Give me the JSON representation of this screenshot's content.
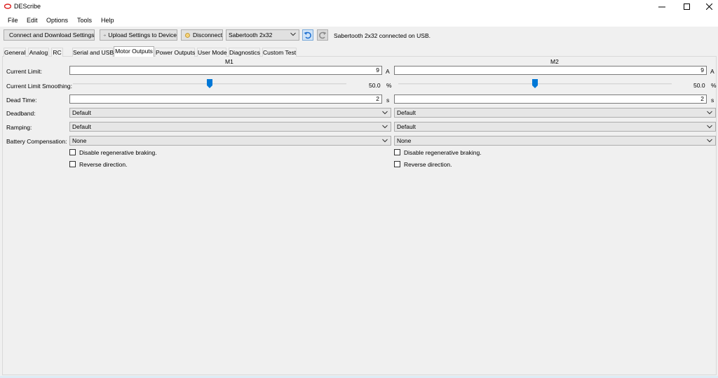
{
  "window": {
    "title": "DEScribe"
  },
  "menu": [
    "File",
    "Edit",
    "Options",
    "Tools",
    "Help"
  ],
  "toolbar": {
    "connect_label": "Connect and Download Settings",
    "upload_label": "Upload Settings to Device",
    "disconnect_label": "Disconnect",
    "device_select": "Sabertooth 2x32",
    "status": "Sabertooth 2x32 connected on USB."
  },
  "tabs": [
    "General",
    "Analog",
    "RC",
    "Serial and USB",
    "Motor Outputs",
    "Power Outputs",
    "User Mode",
    "Diagnostics",
    "Custom Test"
  ],
  "active_tab": "Motor Outputs",
  "columns": {
    "m1": "M1",
    "m2": "M2"
  },
  "labels": {
    "current_limit": "Current Limit:",
    "current_limit_smoothing": "Current Limit Smoothing:",
    "dead_time": "Dead Time:",
    "deadband": "Deadband:",
    "ramping": "Ramping:",
    "battery_compensation": "Battery Compensation:"
  },
  "m1": {
    "current_limit": "9",
    "current_unit": "A",
    "smoothing_value": "50.0",
    "smoothing_unit": "%",
    "smoothing_fraction": 0.5,
    "dead_time": "2",
    "dead_time_unit": "s",
    "deadband": "Default",
    "ramping": "Default",
    "battery_compensation": "None",
    "disable_regen_label": "Disable regenerative braking.",
    "disable_regen_checked": false,
    "reverse_label": "Reverse direction.",
    "reverse_checked": false
  },
  "m2": {
    "current_limit": "9",
    "current_unit": "A",
    "smoothing_value": "50.0",
    "smoothing_unit": "%",
    "smoothing_fraction": 0.5,
    "dead_time": "2",
    "dead_time_unit": "s",
    "deadband": "Default",
    "ramping": "Default",
    "battery_compensation": "None",
    "disable_regen_label": "Disable regenerative braking.",
    "disable_regen_checked": false,
    "reverse_label": "Reverse direction.",
    "reverse_checked": false
  },
  "colors": {
    "slider_thumb": "#0078d7",
    "active_tab": "#ffffff",
    "undo_icon": "#1e6fd0",
    "redo_icon": "#8a8a8a"
  }
}
